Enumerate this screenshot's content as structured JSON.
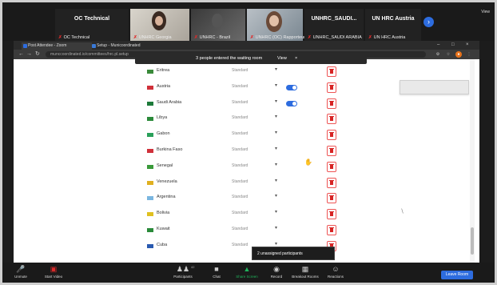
{
  "zoom_tiles": [
    {
      "name": "OC Technical",
      "sub": "OC Technical",
      "video": false
    },
    {
      "name": "",
      "sub": "UNHRC Georgia",
      "video": true
    },
    {
      "name": "",
      "sub": "UNHRC - Brazil",
      "video": true
    },
    {
      "name": "",
      "sub": "UNHRC (OC) Rapporteur",
      "video": true
    },
    {
      "name": "UNHRC_SAUDI...",
      "sub": "UNHRC_SAUDI ARABIA",
      "video": false
    },
    {
      "name": "UN HRC Austria",
      "sub": "UN HRC Austria",
      "video": false
    }
  ],
  "view_label": "View",
  "browser": {
    "tabs": [
      "Post Attendee - Zoom",
      "Setup - Municoordinated"
    ],
    "url": "munccoordinated.io/committees/hrc.pl.setup"
  },
  "waiting_room": {
    "message": "3 people entered the waiting room",
    "view_label": "View",
    "close_label": "×"
  },
  "rows": [
    {
      "country": "Eritrea",
      "role": "Standard",
      "toggle": false,
      "flag": "#3a8a3a"
    },
    {
      "country": "Austria",
      "role": "Standard",
      "toggle": true,
      "flag": "#d0303a"
    },
    {
      "country": "Saudi Arabia",
      "role": "Standard",
      "toggle": true,
      "flag": "#1d7a3a"
    },
    {
      "country": "Libya",
      "role": "Standard",
      "toggle": false,
      "flag": "#2b8a3a"
    },
    {
      "country": "Gabon",
      "role": "Standard",
      "toggle": false,
      "flag": "#2aa05a"
    },
    {
      "country": "Burkina Faso",
      "role": "Standard",
      "toggle": false,
      "flag": "#d0303a"
    },
    {
      "country": "Senegal",
      "role": "Standard",
      "toggle": false,
      "flag": "#3a9a3a"
    },
    {
      "country": "Venezuela",
      "role": "Standard",
      "toggle": false,
      "flag": "#e0b020"
    },
    {
      "country": "Argentina",
      "role": "Standard",
      "toggle": false,
      "flag": "#7ab6e0"
    },
    {
      "country": "Bolivia",
      "role": "Standard",
      "toggle": false,
      "flag": "#e0c020"
    },
    {
      "country": "Kuwait",
      "role": "Standard",
      "toggle": false,
      "flag": "#2a8a3a"
    },
    {
      "country": "Cuba",
      "role": "Standard",
      "toggle": false,
      "flag": "#2a5ab0"
    }
  ],
  "unassigned_popup": "2 unassigned participants",
  "toolbar": {
    "unmute": "Unmute",
    "start_video": "Start Video",
    "participants": "Participants",
    "participants_count": "42",
    "chat": "Chat",
    "share_screen": "Share Screen",
    "record": "Record",
    "breakout_rooms": "Breakout Rooms",
    "reactions": "Reactions",
    "leave_room": "Leave Room"
  },
  "colors": {
    "accent": "#2d6cdf",
    "danger": "#d62424",
    "share": "#1fb35b"
  }
}
